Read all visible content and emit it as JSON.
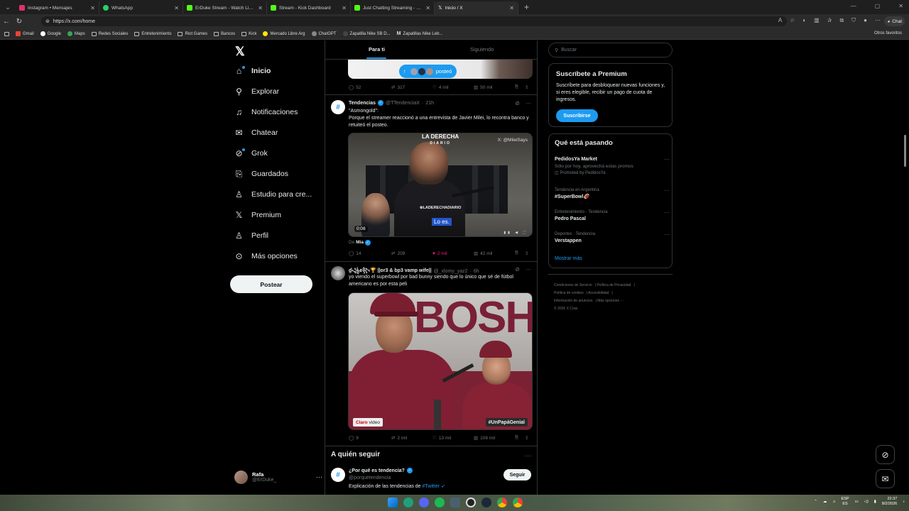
{
  "browser": {
    "tabs": [
      {
        "title": "Instagram • Mensajes",
        "color": "#e1306c"
      },
      {
        "title": "WhatsApp",
        "color": "#25d366"
      },
      {
        "title": "ErDuke Stream - Watch Live on Kick",
        "color": "#53fc18"
      },
      {
        "title": "Stream - Kick Dashboard",
        "color": "#53fc18"
      },
      {
        "title": "Just Chatting Streaming - Live Streams",
        "color": "#53fc18"
      },
      {
        "title": "Inicio / X",
        "color": "#ffffff"
      }
    ],
    "url": "https://x.com/home",
    "chat_label": "Chat",
    "bookmarks": [
      "Gmail",
      "Google",
      "Maps",
      "Redes Sociales",
      "Entretenimiento",
      "Riot Games",
      "Bancos",
      "Kick",
      "Mercado Libre Arg",
      "ChatGPT",
      "Zapatilla Nike SB D...",
      "Zapatillas Nike Leb..."
    ],
    "other_bookmarks": "Otros favoritos"
  },
  "nav": {
    "logo": "𝕏",
    "items": [
      {
        "label": "Inicio",
        "icon": "home-icon",
        "glyph": "⌂"
      },
      {
        "label": "Explorar",
        "icon": "search-icon",
        "glyph": "⚲"
      },
      {
        "label": "Notificaciones",
        "icon": "bell-icon",
        "glyph": "♫"
      },
      {
        "label": "Chatear",
        "icon": "mail-icon",
        "glyph": "✉"
      },
      {
        "label": "Grok",
        "icon": "grok-icon",
        "glyph": "⊘"
      },
      {
        "label": "Guardados",
        "icon": "bookmark-icon",
        "glyph": "⎘"
      },
      {
        "label": "Estudio para cre...",
        "icon": "studio-icon",
        "glyph": "♙"
      },
      {
        "label": "Premium",
        "icon": "x-premium-icon",
        "glyph": "𝕏"
      },
      {
        "label": "Perfil",
        "icon": "person-icon",
        "glyph": "♙"
      },
      {
        "label": "Más opciones",
        "icon": "more-circle-icon",
        "glyph": "⋯"
      }
    ],
    "post_label": "Postear",
    "account": {
      "name": "Rafa",
      "handle": "@ErDuke_"
    }
  },
  "feed": {
    "tabs": [
      "Para ti",
      "Siguiendo"
    ],
    "posted_pill": "posteó",
    "prev_stats": {
      "replies": "52",
      "reposts": "317",
      "likes": "4 mil",
      "views": "50 mil"
    },
    "post1": {
      "author": "Tendencias",
      "handle": "@TTendenciaX",
      "time": "21h",
      "lines": [
        "\"Asmongold\":",
        "Porque el streamer reaccionó a una entrevista de Javier Milei, lo recontra banco y retuiteó el posteo."
      ],
      "video_watermark_top": "LA DERECHA",
      "video_watermark_sub": "DIARIO",
      "video_handle": "X: @MileiSays",
      "video_center": "⊗LADERECHADIARIO",
      "caption": "Lo es.",
      "time_badge": "0:08",
      "from_label": "De",
      "from_name": "Mia",
      "stats": {
        "replies": "14",
        "reposts": "209",
        "likes": "2 mil",
        "views": "42 mil"
      }
    },
    "post2": {
      "author": "ɠ꧁ꫀ꧂🏆 ||or3 & bp3 vamp wife||",
      "handle": "@_xlomy_yaz2",
      "time": "6h",
      "text": "yo viendo el superbowl por bad bunny siendo que lo único que sé de fútbol americano es por esta peli",
      "bg_text": "BOSH",
      "tag_left": "Claro",
      "tag_left_2": "video",
      "tag_right": "#UnPapáGenial",
      "stats": {
        "replies": "9",
        "reposts": "2 mil",
        "likes": "13 mil",
        "views": "108 mil"
      }
    },
    "who_to_follow": {
      "title": "A quién seguir",
      "name": "¿Por qué es tendencia?",
      "handle": "@porquetendencia",
      "desc_prefix": "Explicación de las tendencias de",
      "desc_link": "#Twitter",
      "follow_label": "Seguir"
    }
  },
  "right": {
    "search_placeholder": "Buscar",
    "premium": {
      "title": "Suscríbete a Premium",
      "text": "Suscríbete para desbloquear nuevas funciones y, si eres elegible, recibir un pago de cuota de ingresos.",
      "button": "Suscribirse"
    },
    "trends_title": "Qué está pasando",
    "trends": [
      {
        "meta": "",
        "name": "PedidosYa Market",
        "sub": "Sólo por hoy, aprovechá estas promos",
        "extra": "Promoted by PedidosYa"
      },
      {
        "meta": "Tendencia en Argentina",
        "name": "#SuperBowl🏈",
        "sub": "",
        "extra": ""
      },
      {
        "meta": "Entretenimiento · Tendencia",
        "name": "Pedro Pascal",
        "sub": "",
        "extra": ""
      },
      {
        "meta": "Deportes · Tendencia",
        "name": "Verstappen",
        "sub": "",
        "extra": ""
      }
    ],
    "show_more": "Mostrar más",
    "footer": [
      "Condiciones de Servicio",
      "Política de Privacidad",
      "Política de cookies",
      "Accesibilidad",
      "Información de anuncios",
      "Más opciones ···",
      "© 2026 X Corp."
    ]
  },
  "taskbar": {
    "lang_top": "ESP",
    "lang_bottom": "ES",
    "time": "22:37",
    "date": "8/2/2026"
  }
}
